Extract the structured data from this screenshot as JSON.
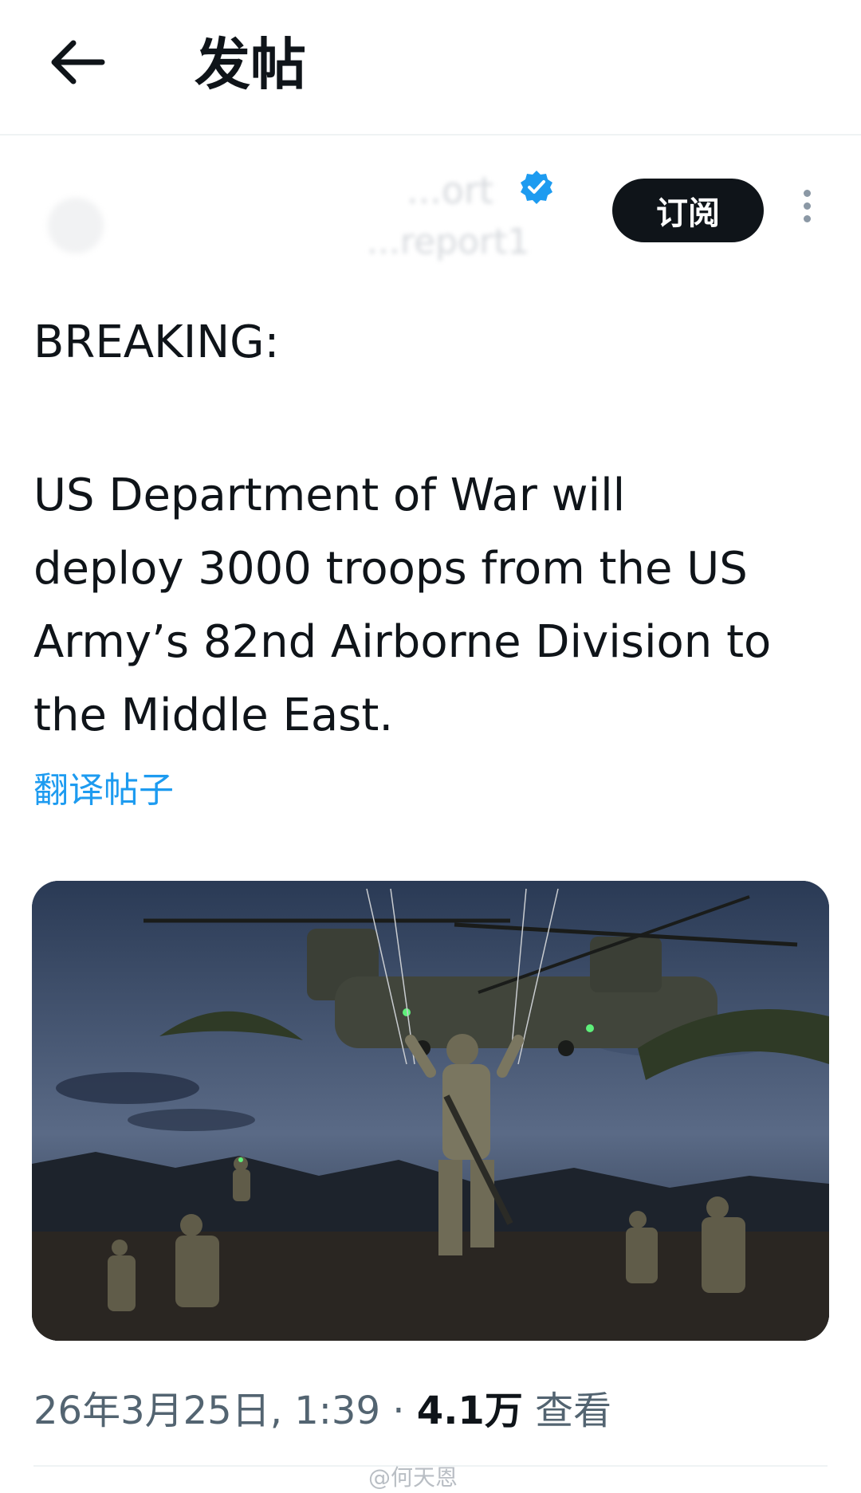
{
  "header": {
    "title": "发帖"
  },
  "author": {
    "name": "...ort",
    "handle": "...report1"
  },
  "subscribe_label": "订阅",
  "post": {
    "line1": "BREAKING:",
    "line2": "US Department of War will deploy 3000 troops from the US Army’s 82nd Airborne Division to the Middle East."
  },
  "translate_label": "翻译帖子",
  "meta": {
    "date": "26年3月25日, 1:39",
    "separator": " · ",
    "views": "4.1万",
    "views_label": " 查看"
  },
  "watermark": "@何天恩",
  "colors": {
    "accent": "#1d9bf0",
    "button_bg": "#0f1419",
    "secondary_text": "#536471"
  }
}
